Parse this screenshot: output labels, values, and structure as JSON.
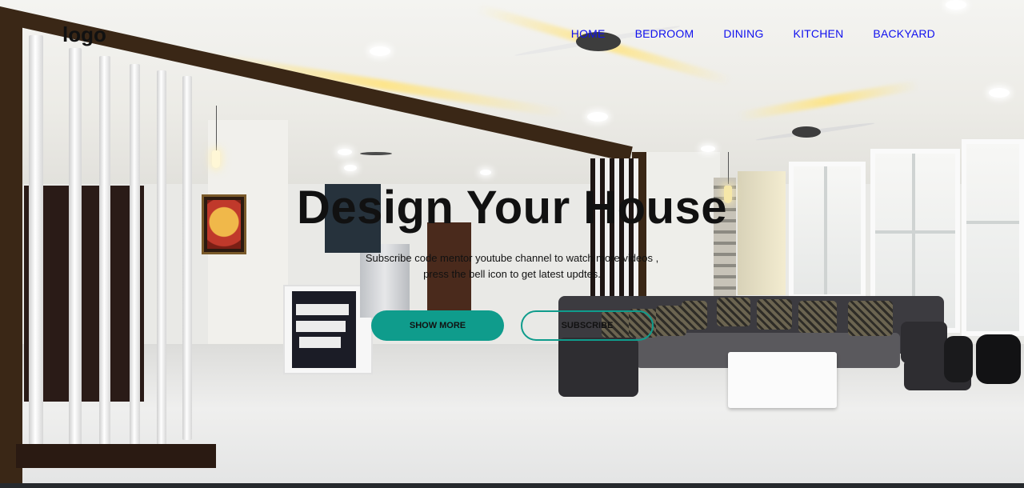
{
  "brand": {
    "logo_text": "logo"
  },
  "nav": {
    "items": [
      {
        "label": "HOME"
      },
      {
        "label": "BEDROOM"
      },
      {
        "label": "DINING"
      },
      {
        "label": "KITCHEN"
      },
      {
        "label": "BACKYARD"
      }
    ]
  },
  "hero": {
    "title": "Design Your House",
    "subtitle_line1": "Subscribe code mentor youtube channel to watch more videos ,",
    "subtitle_line2": "press the bell icon to get latest updtes.",
    "primary_button": "SHOW MORE",
    "secondary_button": "SUBSCRIBE"
  },
  "colors": {
    "accent": "#0f9c8c",
    "nav_link": "#1010ee",
    "text": "#111111"
  },
  "background": {
    "image_subject": "living-room-interior-photo"
  }
}
